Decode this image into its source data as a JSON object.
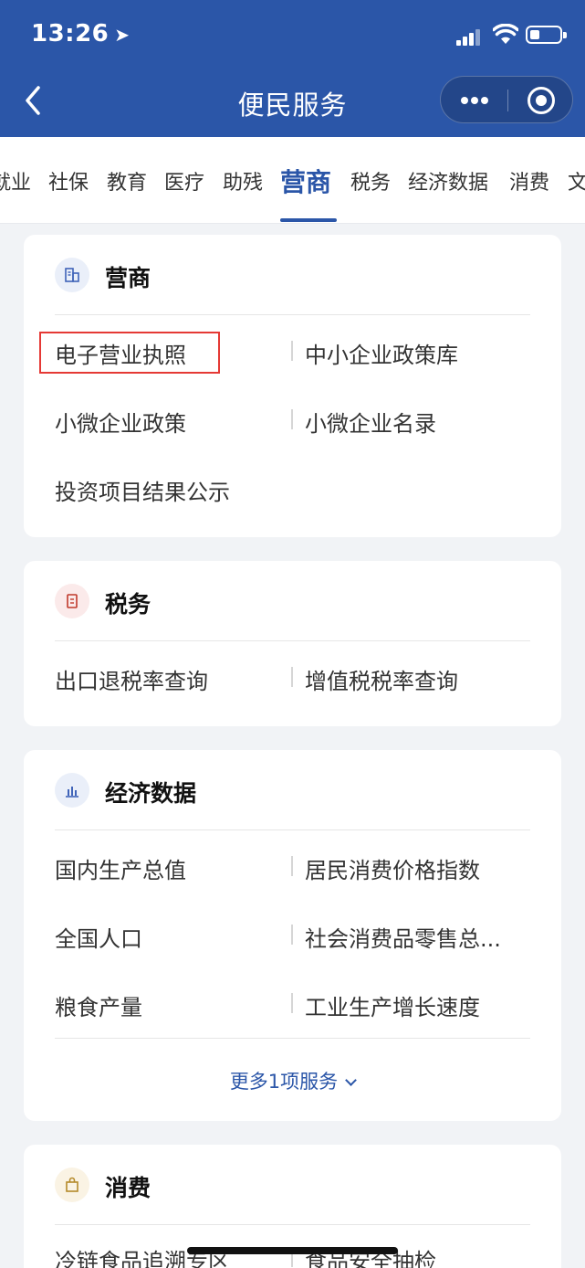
{
  "status_bar": {
    "time": "13:26"
  },
  "nav": {
    "title": "便民服务"
  },
  "tabs": [
    "就业",
    "社保",
    "教育",
    "医疗",
    "助残",
    "营商",
    "税务",
    "经济数据",
    "消费",
    "文"
  ],
  "active_tab": "营商",
  "cards": [
    {
      "title": "营商",
      "icon": "building-icon",
      "icon_color": "#3f63b8",
      "items": [
        "电子营业执照",
        "中小企业政策库",
        "小微企业政策",
        "小微企业名录",
        "投资项目结果公示"
      ]
    },
    {
      "title": "税务",
      "icon": "tax-doc-icon",
      "icon_color": "#c0392b",
      "items": [
        "出口退税率查询",
        "增值税税率查询"
      ]
    },
    {
      "title": "经济数据",
      "icon": "bar-chart-icon",
      "icon_color": "#3f63b8",
      "items": [
        "国内生产总值",
        "居民消费价格指数",
        "全国人口",
        "社会消费品零售总...",
        "粮食产量",
        "工业生产增长速度"
      ],
      "more_label": "更多1项服务"
    },
    {
      "title": "消费",
      "icon": "shopping-bag-icon",
      "icon_color": "#b58a2a",
      "items": [
        "冷链食品追溯专区",
        "食品安全抽检"
      ]
    }
  ],
  "colors": {
    "brand": "#2b56a8",
    "highlight": "#e53935",
    "background": "#f1f3f6"
  }
}
